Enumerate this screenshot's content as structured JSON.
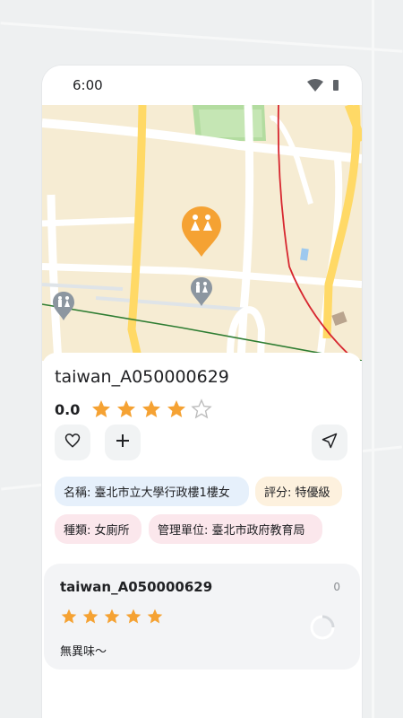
{
  "status_bar": {
    "time": "6:00",
    "wifi_icon": "wifi-icon",
    "battery_icon": "battery-icon"
  },
  "map": {
    "marker_selected_icon": "restroom-marker-icon",
    "marker_icon": "restroom-marker-icon"
  },
  "place": {
    "title": "taiwan_A050000629",
    "rating_value": "0.0",
    "rating_stars": 4,
    "max_stars": 5
  },
  "actions": {
    "favorite_icon": "heart-icon",
    "add_icon": "plus-icon",
    "navigate_icon": "navigate-icon"
  },
  "chips": {
    "name": "名稱: 臺北市立大學行政樓1樓女",
    "grade": "評分: 特優級",
    "type": "種類: 女廁所",
    "manager": "管理單位: 臺北市政府教育局"
  },
  "review": {
    "title": "taiwan_A050000629",
    "count": "0",
    "stars": 5,
    "text": "無異味～"
  },
  "colors": {
    "star": "#f5a233",
    "marker_selected": "#f5a233",
    "marker": "#8c96a0",
    "map_bg": "#f6ecd3",
    "road_major": "#ffd966",
    "park": "#b3dca0"
  }
}
